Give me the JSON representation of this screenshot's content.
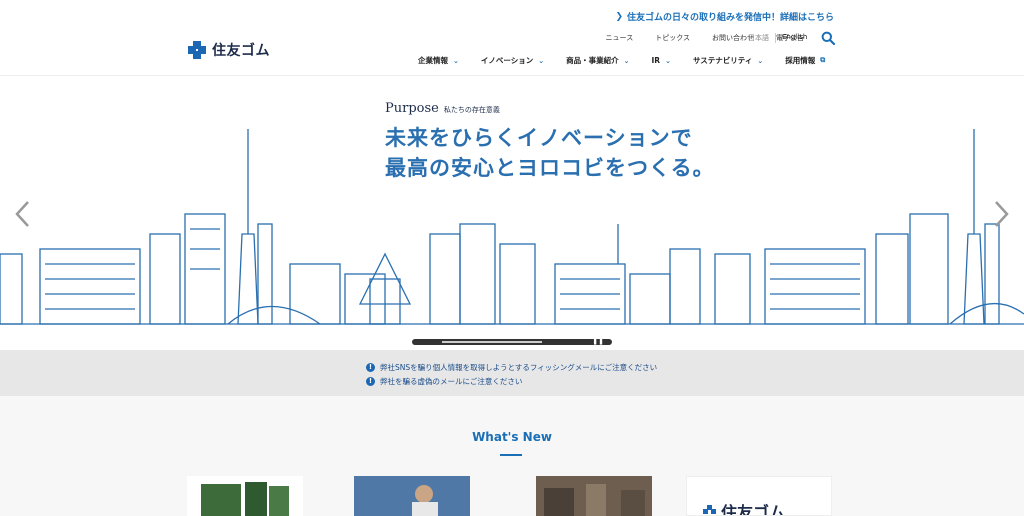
{
  "header": {
    "banner": "住友ゴムの日々の取り組みを発信中！詳細はこちら",
    "logo_text": "住友ゴム",
    "util_nav": [
      "ニュース",
      "トピックス",
      "お問い合わせ",
      "電子公告"
    ],
    "lang_jp": "日本語",
    "lang_en": "English",
    "main_nav": [
      "企業情報",
      "イノベーション",
      "商品・事業紹介",
      "IR",
      "サステナビリティ",
      "採用情報"
    ]
  },
  "hero": {
    "purpose_en": "Purpose",
    "purpose_jp": "私たちの存在意義",
    "tagline_line1": "未来をひらくイノベーションで",
    "tagline_line2": "最高の安心とヨロコビをつくる。"
  },
  "notices": [
    "弊社SNSを騙り個人情報を取得しようとするフィッシングメールにご注意ください",
    "弊社を騙る虚偽のメールにご注意ください"
  ],
  "news": {
    "title": "What's New",
    "card4_brand": "住友ゴム"
  },
  "colors": {
    "brand_blue": "#1c67b3",
    "link_blue": "#1a6fb7",
    "notice_bg": "#e7e7e7"
  }
}
